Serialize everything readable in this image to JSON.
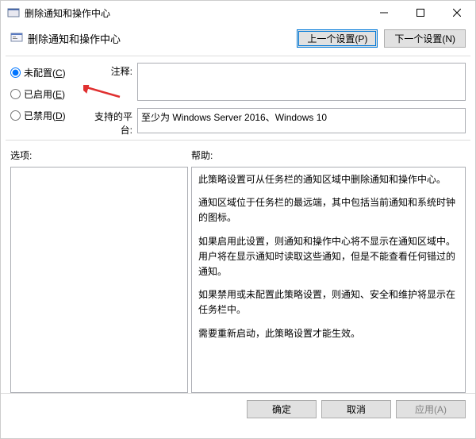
{
  "window": {
    "title": "删除通知和操作中心"
  },
  "header": {
    "title": "删除通知和操作中心"
  },
  "nav": {
    "prev": "上一个设置(P)",
    "next": "下一个设置(N)"
  },
  "radios": {
    "not_configured": {
      "label": "未配置(",
      "key": "C",
      "suffix": ")"
    },
    "enabled": {
      "label": "已启用(",
      "key": "E",
      "suffix": ")"
    },
    "disabled": {
      "label": "已禁用(",
      "key": "D",
      "suffix": ")"
    },
    "selected": "not_configured"
  },
  "fields": {
    "comment_label": "注释:",
    "comment_value": "",
    "platform_label": "支持的平台:",
    "platform_value": "至少为 Windows Server 2016、Windows 10"
  },
  "sections": {
    "options_label": "选项:",
    "help_label": "帮助:"
  },
  "help_paragraphs": [
    "此策略设置可从任务栏的通知区域中删除通知和操作中心。",
    "通知区域位于任务栏的最远端，其中包括当前通知和系统时钟的图标。",
    "如果启用此设置，则通知和操作中心将不显示在通知区域中。用户将在显示通知时读取这些通知，但是不能查看任何错过的通知。",
    "如果禁用或未配置此策略设置，则通知、安全和维护将显示在任务栏中。",
    "需要重新启动，此策略设置才能生效。"
  ],
  "footer": {
    "ok": "确定",
    "cancel": "取消",
    "apply": "应用(A)"
  }
}
